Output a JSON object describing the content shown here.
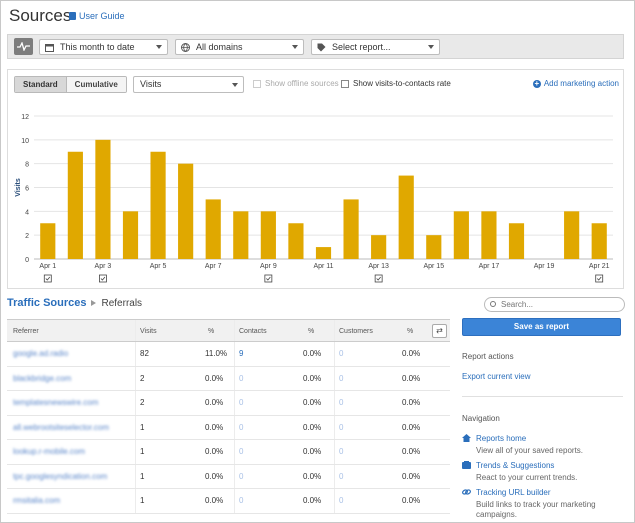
{
  "header": {
    "title": "Sources",
    "user_guide": "User Guide"
  },
  "toolbar": {
    "date_range": "This month to date",
    "domains": "All domains",
    "report": "Select report..."
  },
  "chart_controls": {
    "standard": "Standard",
    "cumulative": "Cumulative",
    "metric": "Visits",
    "show_offline": "Show offline sources",
    "show_rate": "Show visits-to-contacts rate",
    "add_action": "Add marketing action"
  },
  "chart_data": {
    "type": "bar",
    "ylabel": "Visits",
    "ylim": [
      0,
      12
    ],
    "yticks": [
      0,
      2,
      4,
      6,
      8,
      10,
      12
    ],
    "bar_color": "#e0a800",
    "grid": true,
    "categories": [
      "Apr 1",
      "Apr 2",
      "Apr 3",
      "Apr 4",
      "Apr 5",
      "Apr 6",
      "Apr 7",
      "Apr 8",
      "Apr 9",
      "Apr 10",
      "Apr 11",
      "Apr 12",
      "Apr 13",
      "Apr 14",
      "Apr 15",
      "Apr 16",
      "Apr 17",
      "Apr 18",
      "Apr 19",
      "Apr 20",
      "Apr 21"
    ],
    "tick_labels": [
      "Apr 1",
      "",
      "Apr 3",
      "",
      "Apr 5",
      "",
      "Apr 7",
      "",
      "Apr 9",
      "",
      "Apr 11",
      "",
      "Apr 13",
      "",
      "Apr 15",
      "",
      "Apr 17",
      "",
      "Apr 19",
      "",
      "Apr 21"
    ],
    "values": [
      3,
      9,
      10,
      4,
      9,
      8,
      5,
      4,
      4,
      3,
      1,
      5,
      2,
      7,
      2,
      4,
      4,
      3,
      0,
      4,
      3
    ],
    "event_markers": [
      "Apr 1",
      "Apr 3",
      "Apr 9",
      "Apr 13",
      "Apr 21"
    ]
  },
  "breadcrumb": {
    "main": "Traffic Sources",
    "current": "Referrals"
  },
  "search": {
    "placeholder": "Search..."
  },
  "table": {
    "columns": [
      "Referrer",
      "Visits",
      "%",
      "Contacts",
      "%",
      "Customers",
      "%"
    ],
    "rows": [
      {
        "referrer": "google.ad.radio",
        "visits": "82",
        "visits_pct": "11.0%",
        "contacts": "9",
        "contacts_pct": "0.0%",
        "customers": "0",
        "customers_pct": "0.0%"
      },
      {
        "referrer": "blackbridge.com",
        "visits": "2",
        "visits_pct": "0.0%",
        "contacts": "0",
        "contacts_pct": "0.0%",
        "customers": "0",
        "customers_pct": "0.0%"
      },
      {
        "referrer": "templatesnewswire.com",
        "visits": "2",
        "visits_pct": "0.0%",
        "contacts": "0",
        "contacts_pct": "0.0%",
        "customers": "0",
        "customers_pct": "0.0%"
      },
      {
        "referrer": "all.webrootsiteselector.com",
        "visits": "1",
        "visits_pct": "0.0%",
        "contacts": "0",
        "contacts_pct": "0.0%",
        "customers": "0",
        "customers_pct": "0.0%"
      },
      {
        "referrer": "lookup.r-mobile.com",
        "visits": "1",
        "visits_pct": "0.0%",
        "contacts": "0",
        "contacts_pct": "0.0%",
        "customers": "0",
        "customers_pct": "0.0%"
      },
      {
        "referrer": "tpc.googlesyndication.com",
        "visits": "1",
        "visits_pct": "0.0%",
        "contacts": "0",
        "contacts_pct": "0.0%",
        "customers": "0",
        "customers_pct": "0.0%"
      },
      {
        "referrer": "rmsitalia.com",
        "visits": "1",
        "visits_pct": "0.0%",
        "contacts": "0",
        "contacts_pct": "0.0%",
        "customers": "0",
        "customers_pct": "0.0%"
      }
    ]
  },
  "sidebar": {
    "save_button": "Save as report",
    "report_actions_heading": "Report actions",
    "export_link": "Export current view",
    "navigation_heading": "Navigation",
    "nav": [
      {
        "label": "Reports home",
        "desc": "View all of your saved reports.",
        "icon": "home-icon"
      },
      {
        "label": "Trends & Suggestions",
        "desc": "React to your current trends.",
        "icon": "trends-icon"
      },
      {
        "label": "Tracking URL builder",
        "desc": "Build links to track your marketing campaigns.",
        "icon": "link-icon"
      }
    ]
  }
}
